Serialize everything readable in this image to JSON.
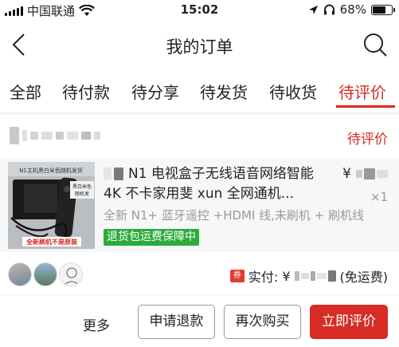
{
  "status_bar": {
    "carrier": "中国联通",
    "time": "15:02",
    "battery": "68%",
    "battery_level": 0.68
  },
  "nav": {
    "title": "我的订单"
  },
  "tabs": [
    {
      "label": "全部"
    },
    {
      "label": "待付款"
    },
    {
      "label": "待分享"
    },
    {
      "label": "待发货"
    },
    {
      "label": "待收货"
    },
    {
      "label": "待评价",
      "active": true
    }
  ],
  "order": {
    "status": "待评价",
    "product": {
      "name": "N1 电视盒子无线语音网络智能 4K 不卡家用斐 xun 全网通机...",
      "spec": "全新 N1+ 蓝牙遥控 +HDMI 线,未刷机 + 刷机线",
      "badge": "退货包运费保障中",
      "price_symbol": "¥",
      "quantity": "×1",
      "image_caption_top": "N1主机黑白米色随机发货",
      "image_label_1": "黑白米色",
      "image_label_2": "随机发",
      "image_caption_bottom": "全新刷机不是原装"
    },
    "paid_label": "实付:",
    "paid_symbol": "¥",
    "shipping": "(免运费)",
    "coupon": "券"
  },
  "actions": {
    "more": "更多",
    "refund": "申请退款",
    "rebuy": "再次购买",
    "review": "立即评价"
  },
  "colors": {
    "accent": "#d72b25",
    "badge": "#2cab3c"
  }
}
